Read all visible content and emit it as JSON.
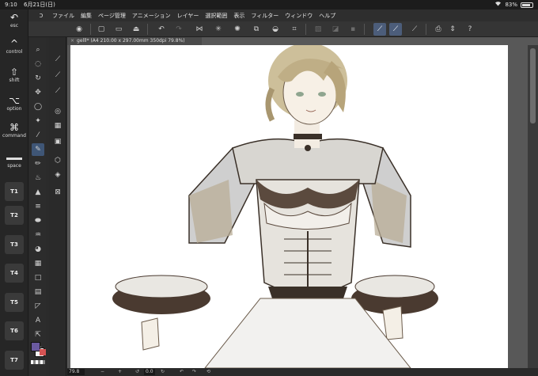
{
  "status_bar": {
    "time": "9:10",
    "date": "6月21日(日)",
    "battery": "83%",
    "battery_level": 0.83
  },
  "keyboard_panel": {
    "esc": "esc",
    "control": "control",
    "shift": "shift",
    "option": "option",
    "command": "command",
    "space": "space",
    "tab_keys": [
      "T1",
      "T2",
      "T3",
      "T4",
      "T5",
      "T6",
      "T7"
    ]
  },
  "menu": {
    "items": [
      "ファイル",
      "編集",
      "ページ管理",
      "アニメーション",
      "レイヤー",
      "選択範囲",
      "表示",
      "フィルター",
      "ウィンドウ",
      "ヘルプ"
    ]
  },
  "document": {
    "tab_title": "gelll* (A4 210.00 x 297.00mm 350dpi 79.8%)"
  },
  "navigator": {
    "zoom": "79.8",
    "rotation": "0.0"
  },
  "colors": {
    "accent": "#4c5d7a",
    "main_color": "#6a5aa0",
    "sub_color": "#f2f2f2",
    "canvas_bg": "#585858"
  }
}
